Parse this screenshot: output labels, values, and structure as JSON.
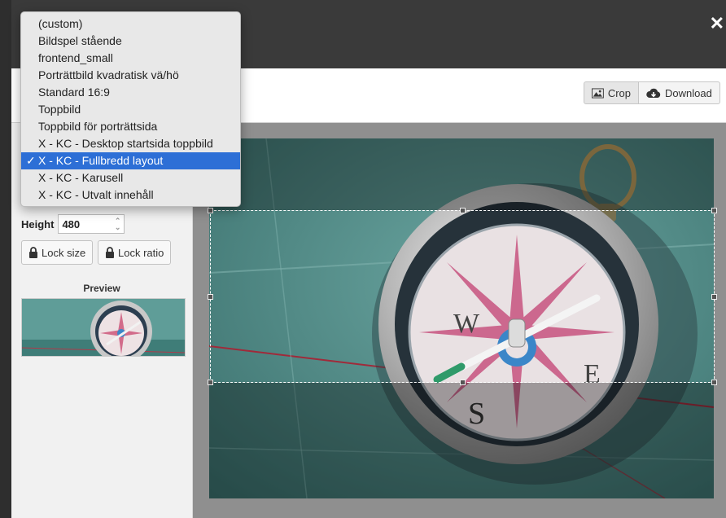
{
  "window": {
    "close_label": "✕"
  },
  "toolbar": {
    "crop_label": "Crop",
    "download_label": "Download"
  },
  "dropdown": {
    "items": [
      {
        "label": "(custom)"
      },
      {
        "label": "Bildspel stående"
      },
      {
        "label": "frontend_small"
      },
      {
        "label": "Porträttbild kvadratisk vä/hö"
      },
      {
        "label": "Standard 16:9"
      },
      {
        "label": "Toppbild"
      },
      {
        "label": "Toppbild för porträttsida"
      },
      {
        "label": "X - KC - Desktop startsida toppbild"
      },
      {
        "label": "X - KC - Fullbredd layout"
      },
      {
        "label": "X - KC - Karusell"
      },
      {
        "label": "X - KC - Utvalt innehåll"
      }
    ],
    "selected_index": 8,
    "check_mark": "✓"
  },
  "settings": {
    "height_label": "Height",
    "height_value": "480",
    "lock_size_label": "Lock size",
    "lock_ratio_label": "Lock ratio"
  },
  "preview": {
    "title": "Preview"
  },
  "colors": {
    "overlay": "#3a3a3a",
    "selected": "#2d6fd6",
    "panel": "#f1f1f1",
    "work_area": "#8f8f8f"
  },
  "icons": {
    "close": "close-icon",
    "image": "image-icon",
    "cloud_download": "cloud-download-icon",
    "lock": "lock-icon",
    "check": "check-icon"
  }
}
